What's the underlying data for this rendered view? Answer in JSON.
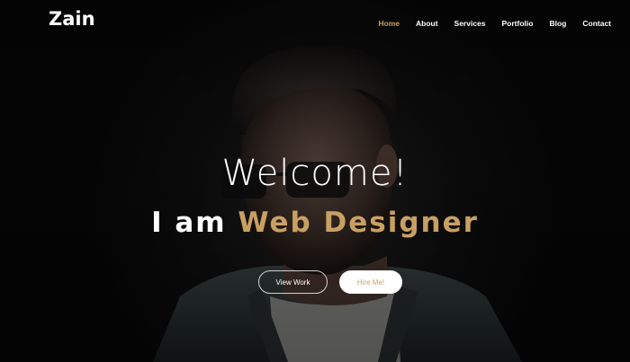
{
  "brand": {
    "logo": "Zain"
  },
  "nav": {
    "items": [
      {
        "label": "Home",
        "active": true
      },
      {
        "label": "About",
        "active": false
      },
      {
        "label": "Services",
        "active": false
      },
      {
        "label": "Portfolio",
        "active": false
      },
      {
        "label": "Blog",
        "active": false
      },
      {
        "label": "Contact",
        "active": false
      }
    ]
  },
  "hero": {
    "welcome": "Welcome!",
    "headline_prefix": "I am",
    "headline_accent": "Web Designer",
    "buttons": {
      "view_work": "View Work",
      "hire_me": "Hire Me!"
    },
    "image": "portrait-photo"
  },
  "colors": {
    "accent": "#c9a063",
    "background": "#050505",
    "text": "#ffffff"
  }
}
